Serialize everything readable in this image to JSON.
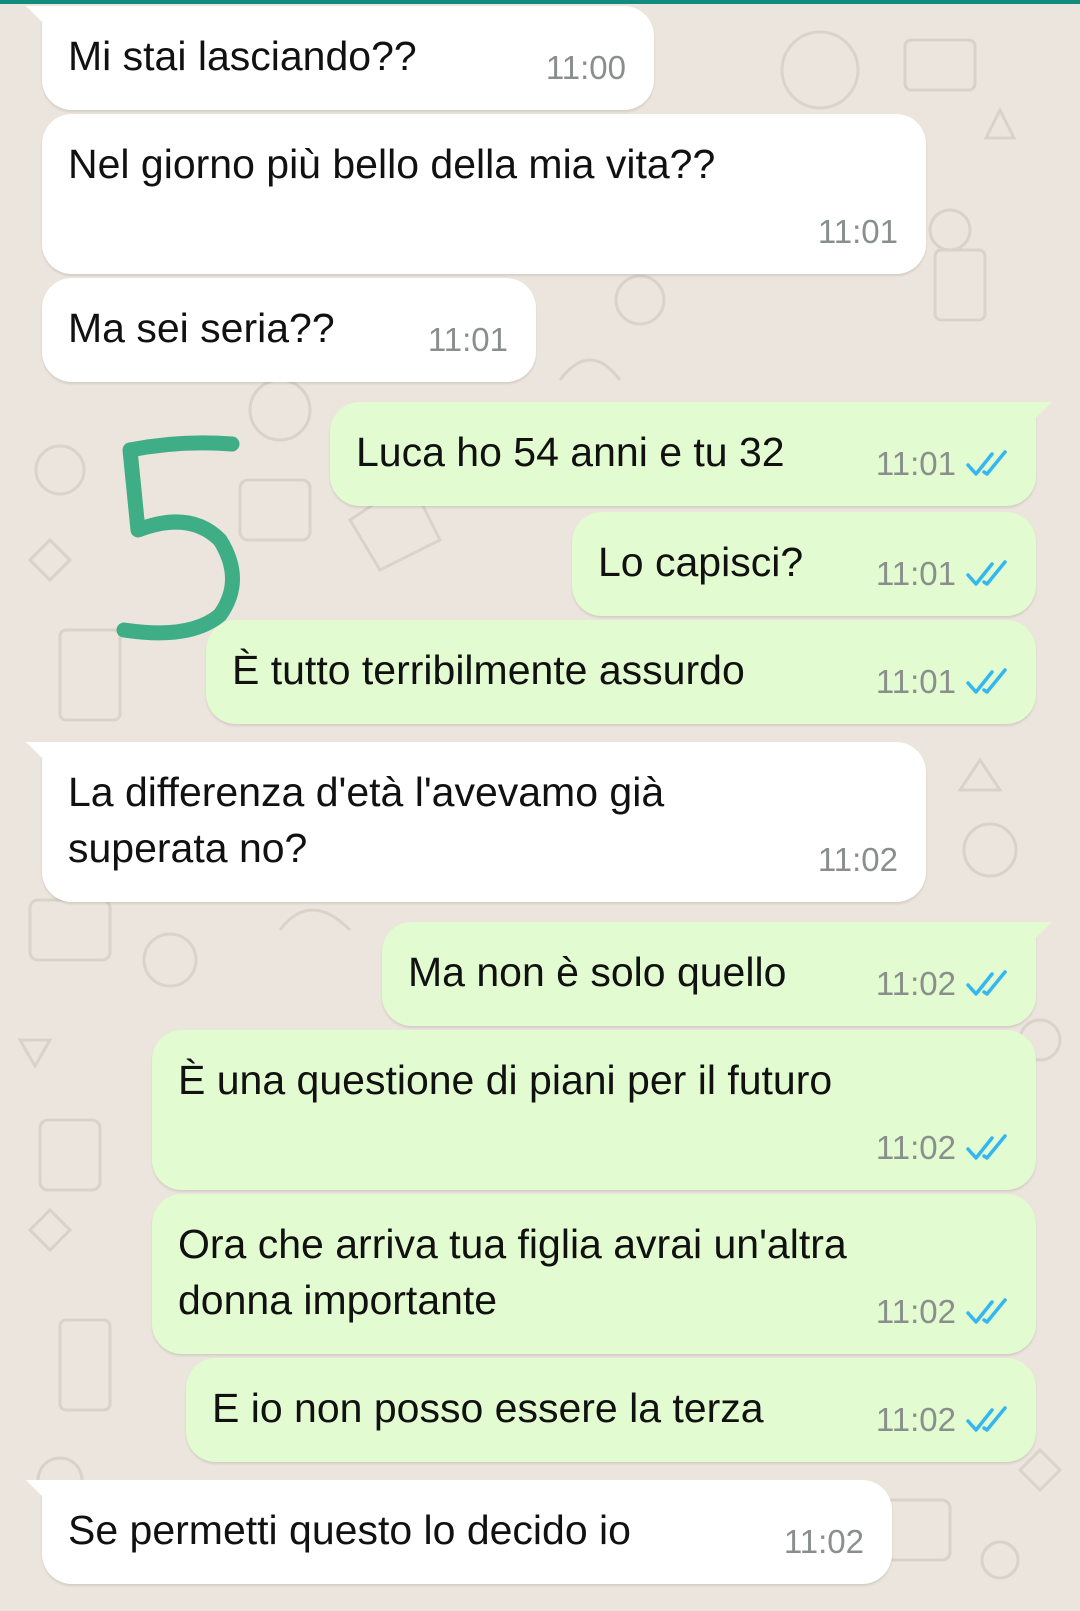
{
  "chat": {
    "messages": [
      {
        "direction": "in",
        "text": "Mi stai lasciando??",
        "time": "11:00"
      },
      {
        "direction": "in",
        "text": "Nel giorno più bello della mia vita??",
        "time": "11:01"
      },
      {
        "direction": "in",
        "text": "Ma sei seria??",
        "time": "11:01"
      },
      {
        "direction": "out",
        "text": "Luca ho 54 anni e tu 32",
        "time": "11:01",
        "status": "read"
      },
      {
        "direction": "out",
        "text": "Lo capisci?",
        "time": "11:01",
        "status": "read"
      },
      {
        "direction": "out",
        "text": "È tutto terribilmente assurdo",
        "time": "11:01",
        "status": "read"
      },
      {
        "direction": "in",
        "text": "La differenza d'età l'avevamo già\nsuperata no?",
        "time": "11:02"
      },
      {
        "direction": "out",
        "text": "Ma non è solo quello",
        "time": "11:02",
        "status": "read"
      },
      {
        "direction": "out",
        "text": "È una questione di piani per il futuro",
        "time": "11:02",
        "status": "read"
      },
      {
        "direction": "out",
        "text": "Ora che arriva tua figlia avrai un'altra\ndonna importante",
        "time": "11:02",
        "status": "read"
      },
      {
        "direction": "out",
        "text": "E io non posso essere la terza",
        "time": "11:02",
        "status": "read"
      },
      {
        "direction": "in",
        "text": "Se permetti questo lo decido io",
        "time": "11:02"
      }
    ]
  },
  "annotation": {
    "text": "5",
    "color": "#3fae87"
  },
  "colors": {
    "incoming_bubble": "#ffffff",
    "outgoing_bubble": "#e2fbd0",
    "read_ticks": "#34b7f1",
    "background": "#ece5dd"
  },
  "icons": {
    "read_receipt": "double-check-icon",
    "wallpaper": "doodle-pattern"
  }
}
